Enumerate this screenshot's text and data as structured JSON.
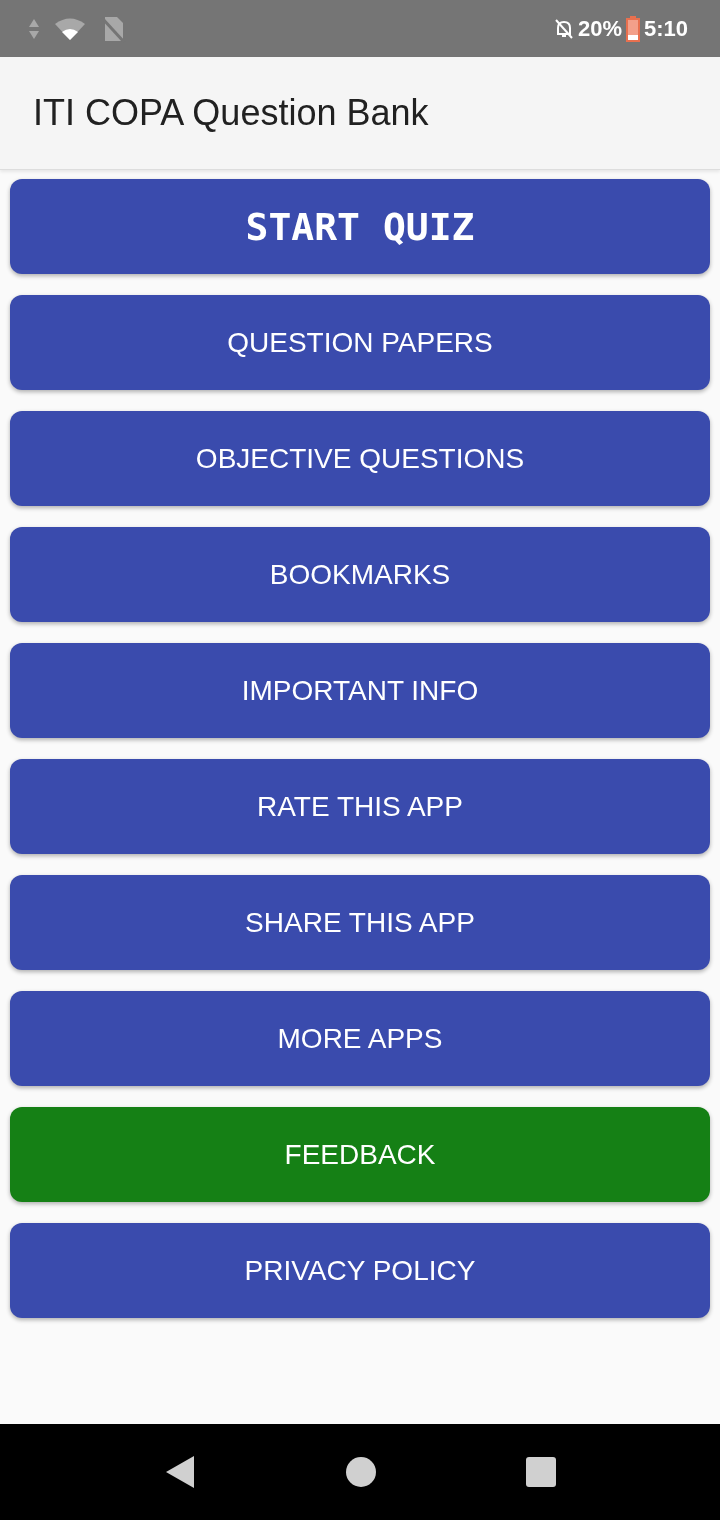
{
  "status_bar": {
    "battery": "20%",
    "time": "5:10"
  },
  "app_bar": {
    "title": "ITI COPA Question Bank"
  },
  "buttons": [
    {
      "label": "START QUIZ",
      "kind": "headline",
      "color": "#3a4bad"
    },
    {
      "label": "QUESTION PAPERS",
      "kind": "normal",
      "color": "#3a4bad"
    },
    {
      "label": "OBJECTIVE QUESTIONS",
      "kind": "normal",
      "color": "#3a4bad"
    },
    {
      "label": "BOOKMARKS",
      "kind": "normal",
      "color": "#3a4bad"
    },
    {
      "label": "IMPORTANT INFO",
      "kind": "normal",
      "color": "#3a4bad"
    },
    {
      "label": "RATE THIS APP",
      "kind": "normal",
      "color": "#3a4bad"
    },
    {
      "label": "SHARE THIS APP",
      "kind": "normal",
      "color": "#3a4bad"
    },
    {
      "label": "MORE APPS",
      "kind": "normal",
      "color": "#3a4bad"
    },
    {
      "label": "FEEDBACK",
      "kind": "normal",
      "color": "#158015"
    },
    {
      "label": "PRIVACY POLICY",
      "kind": "normal",
      "color": "#3a4bad"
    }
  ]
}
